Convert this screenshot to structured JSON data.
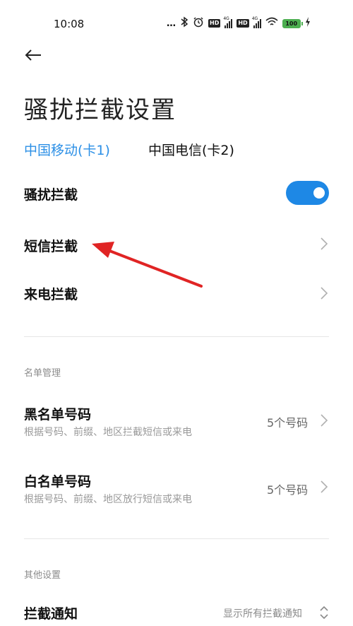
{
  "status_bar": {
    "time": "10:08",
    "dots": "…",
    "network_type_1": "4G",
    "network_type_2": "4G",
    "hd_label": "HD",
    "battery": "100"
  },
  "page": {
    "title": "骚扰拦截设置"
  },
  "sim_tabs": [
    {
      "label": "中国移动(卡1)",
      "selected": true
    },
    {
      "label": "中国电信(卡2)",
      "selected": false
    }
  ],
  "settings": {
    "harassment_block": {
      "label": "骚扰拦截",
      "enabled": true
    },
    "sms_block": {
      "label": "短信拦截"
    },
    "call_block": {
      "label": "来电拦截"
    }
  },
  "list_management": {
    "header": "名单管理",
    "blacklist": {
      "title": "黑名单号码",
      "subtitle": "根据号码、前缀、地区拦截短信或来电",
      "count": "5个号码"
    },
    "whitelist": {
      "title": "白名单号码",
      "subtitle": "根据号码、前缀、地区放行短信或来电",
      "count": "5个号码"
    }
  },
  "other_settings": {
    "header": "其他设置",
    "block_notification": {
      "label": "拦截通知",
      "value": "显示所有拦截通知"
    }
  },
  "colors": {
    "accent": "#2b8fe6",
    "toggle_on": "#1e88e5",
    "annotation_arrow": "#e02424"
  }
}
